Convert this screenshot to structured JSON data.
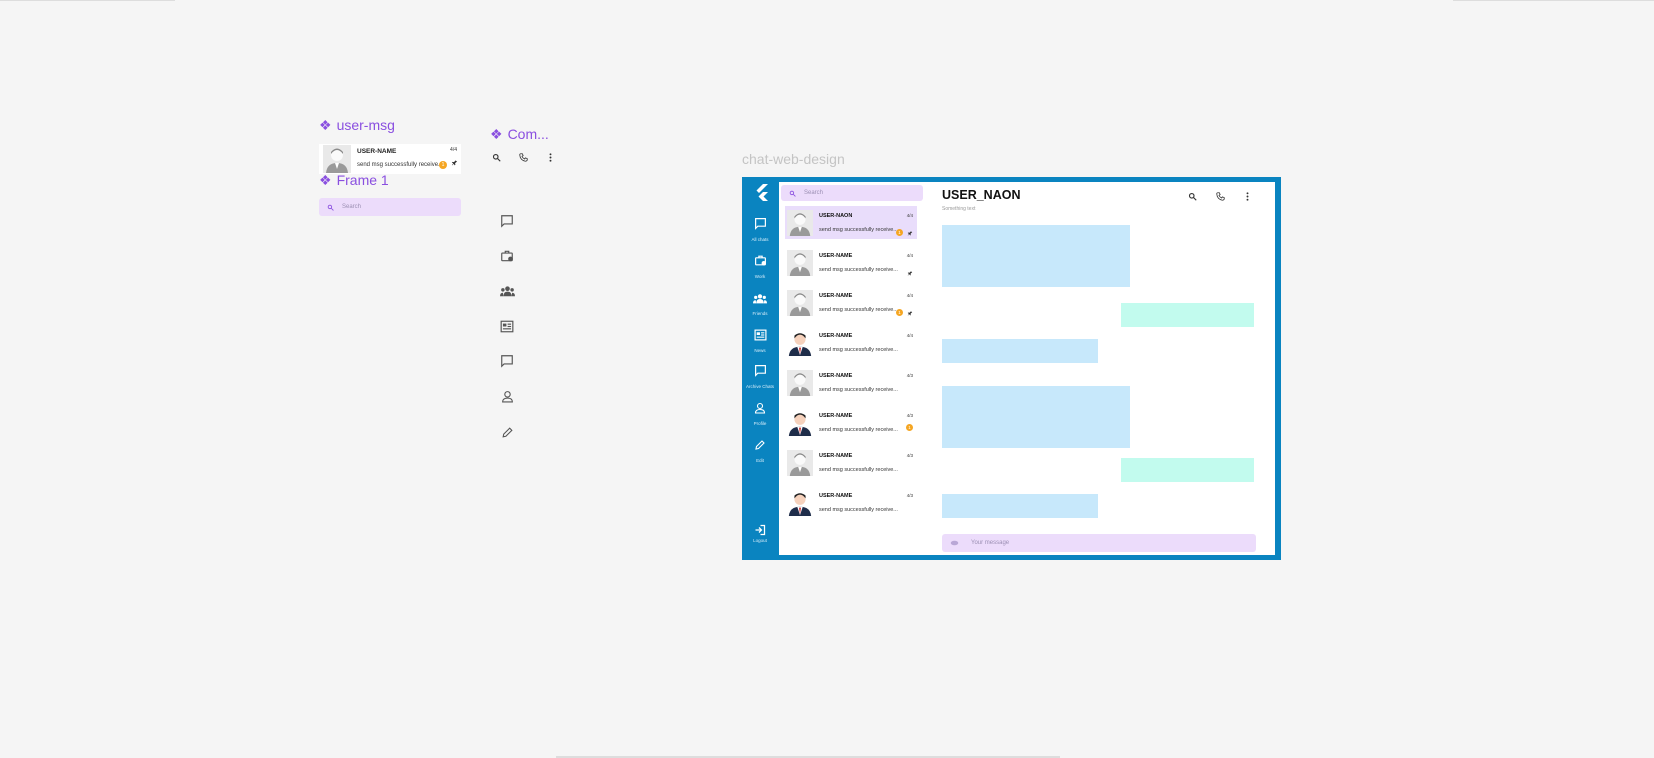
{
  "components": {
    "user_msg": {
      "label": "user-msg",
      "name": "USER-NAME",
      "message": "send msg successfully receive...",
      "time": "4/4",
      "badge": "1"
    },
    "com": {
      "label": "Com..."
    },
    "frame1": {
      "label": "Frame 1",
      "search_placeholder": "Search"
    }
  },
  "frame_title": "chat-web-design",
  "sidebar": {
    "items": [
      {
        "label": "All chats",
        "icon": "chat-bubble-icon"
      },
      {
        "label": "Work",
        "icon": "briefcase-icon"
      },
      {
        "label": "Friends",
        "icon": "group-icon"
      },
      {
        "label": "News",
        "icon": "newspaper-icon"
      },
      {
        "label": "Archive Chats",
        "icon": "chat-bubble-icon"
      },
      {
        "label": "Profile",
        "icon": "person-icon"
      },
      {
        "label": "Edit",
        "icon": "pencil-icon"
      }
    ],
    "logout": {
      "label": "Logout",
      "icon": "logout-icon"
    }
  },
  "chat_list": {
    "search_placeholder": "Search",
    "rows": [
      {
        "name": "USER-NAON",
        "message": "send msg successfully receive...",
        "time": "4/4",
        "badge": "1",
        "pinned": true,
        "avatar": "gray"
      },
      {
        "name": "USER-NAME",
        "message": "send msg successfully receive...",
        "time": "4/4",
        "badge": "",
        "pinned": true,
        "avatar": "gray"
      },
      {
        "name": "USER-NAME",
        "message": "send msg successfully receive...",
        "time": "4/4",
        "badge": "1",
        "pinned": true,
        "avatar": "gray"
      },
      {
        "name": "USER-NAME",
        "message": "send msg successfully receive...",
        "time": "4/4",
        "badge": "",
        "pinned": false,
        "avatar": "suit"
      },
      {
        "name": "USER-NAME",
        "message": "send msg successfully receive...",
        "time": "4/3",
        "badge": "",
        "pinned": false,
        "avatar": "gray"
      },
      {
        "name": "USER-NAME",
        "message": "send msg successfully receive...",
        "time": "4/3",
        "badge": "1",
        "pinned": false,
        "avatar": "suit"
      },
      {
        "name": "USER-NAME",
        "message": "send msg successfully receive...",
        "time": "4/3",
        "badge": "",
        "pinned": false,
        "avatar": "gray"
      },
      {
        "name": "USER-NAME",
        "message": "send msg successfully receive...",
        "time": "4/3",
        "badge": "",
        "pinned": false,
        "avatar": "suit"
      }
    ]
  },
  "chat": {
    "title": "USER_NAON",
    "subtitle": "Something text",
    "input_placeholder": "Your message"
  },
  "colors": {
    "brand": "#0a84c0",
    "accent": "#8a4fe0",
    "badge": "#f5a623",
    "incoming": "#c7e8fb",
    "outgoing": "#c2fbee"
  }
}
